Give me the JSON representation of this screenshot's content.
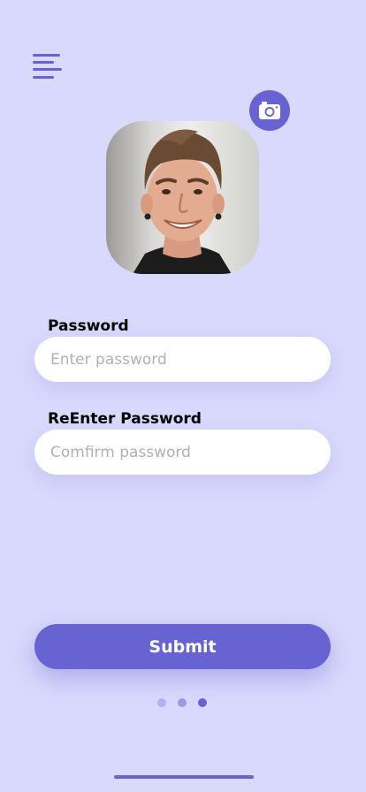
{
  "header": {
    "menu_icon": "hamburger-menu-icon"
  },
  "profile": {
    "camera_icon": "camera-icon",
    "avatar_alt": "profile photo"
  },
  "form": {
    "password_label": "Password",
    "password_placeholder": "Enter password",
    "reenter_label": "ReEnter Password",
    "reenter_placeholder": "Comfirm password"
  },
  "submit_label": "Submit",
  "pagination": {
    "total": 3,
    "active_index": 2
  },
  "colors": {
    "background": "#d9d8fd",
    "accent": "#6763d2",
    "dot_inactive": "#b3b0ee",
    "dot_middle": "#9c98e2"
  }
}
